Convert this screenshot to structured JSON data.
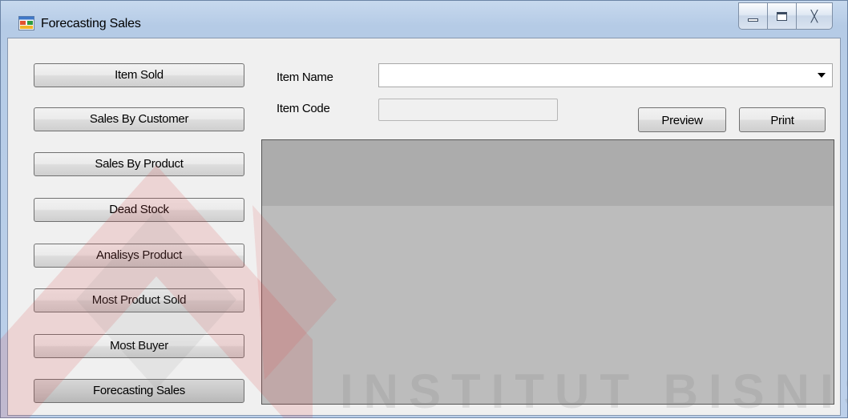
{
  "window": {
    "title": "Forecasting Sales",
    "icon": "app-form-icon",
    "controls": {
      "minimize_icon": "minimize-icon",
      "maximize_icon": "maximize-icon",
      "close_icon": "close-icon",
      "close_glyph": "╳"
    }
  },
  "sidebar": {
    "items": [
      {
        "label": "Item Sold"
      },
      {
        "label": "Sales By Customer"
      },
      {
        "label": "Sales By Product"
      },
      {
        "label": "Dead Stock"
      },
      {
        "label": "Analisys Product"
      },
      {
        "label": "Most Product Sold"
      },
      {
        "label": "Most Buyer"
      },
      {
        "label": "Forecasting Sales",
        "selected": true
      }
    ]
  },
  "form": {
    "item_name_label": "Item Name",
    "item_name_value": "",
    "item_code_label": "Item Code",
    "item_code_value": ""
  },
  "actions": {
    "preview_label": "Preview",
    "print_label": "Print"
  },
  "watermark": {
    "text": "INSTITUT BISNIS",
    "logo_colors": [
      "#d9534f",
      "#8a8a8a"
    ]
  }
}
